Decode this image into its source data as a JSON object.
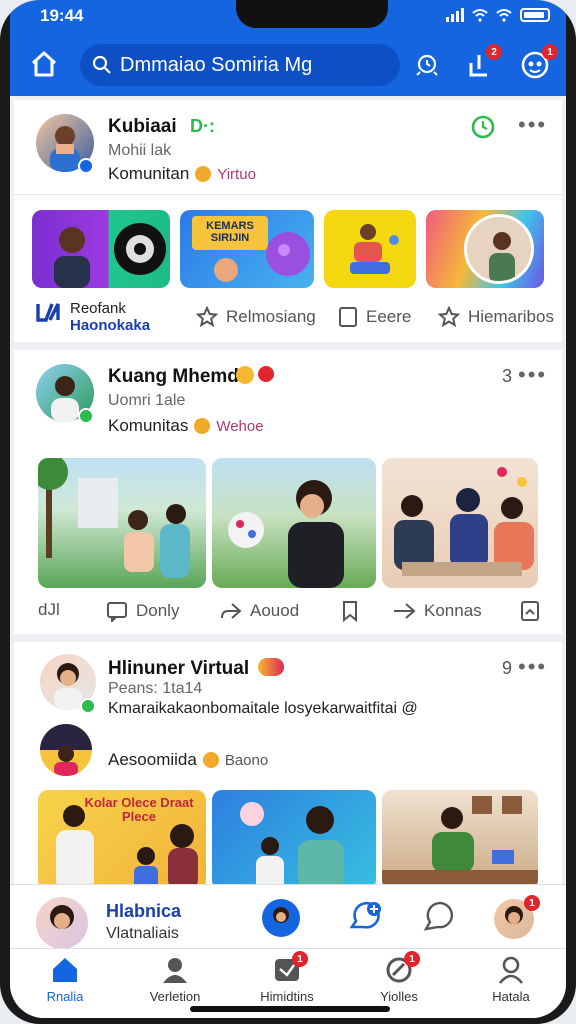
{
  "status": {
    "time": "19:44"
  },
  "header": {
    "search_placeholder": "Dmmaiao Somiria Mg",
    "badges": {
      "share": "2",
      "profile": "1"
    }
  },
  "post1": {
    "name": "Kubiaai",
    "name_emoji": "D·:",
    "sub": "Mohii lak",
    "community": "Komunitan",
    "tag": "Yirtuo",
    "brand_line1": "Reofank",
    "brand_line2": "Haonokaka",
    "actions": [
      "Relmosiang",
      "Eeere",
      "Hiemaribos"
    ]
  },
  "post2": {
    "name": "Kuang Mhemd",
    "sub": "Uomri 1ale",
    "community": "Komunitas",
    "tag": "Wehoe",
    "count": "3",
    "actions": [
      "Donly",
      "Aouod",
      "Konnas"
    ],
    "left_action": "dJl"
  },
  "post3": {
    "name": "Hlinuner Virtual",
    "sub": "Peans: 1ta14",
    "text": "Kmaraikakaonbomaitale losyekarwaitfitai @",
    "community": "Aesoomiida",
    "tag": "Baono",
    "count": "9"
  },
  "tiles": {
    "top_banner": "KEMARS SIRIJIN",
    "mid_banner": "Kolar Olece Draat Plece"
  },
  "dock": {
    "name": "Hlabnica",
    "sub": "Vlatnaliais",
    "badge": "1"
  },
  "nav": {
    "items": [
      "Rnalia",
      "Verletion",
      "Himidtins",
      "Yiolles",
      "Hatala"
    ],
    "badges": {
      "messages": "1",
      "notifications": "1"
    }
  },
  "colors": {
    "brand": "#1565e0",
    "badge": "#e0262b",
    "accent_green": "#2dbb4d"
  }
}
